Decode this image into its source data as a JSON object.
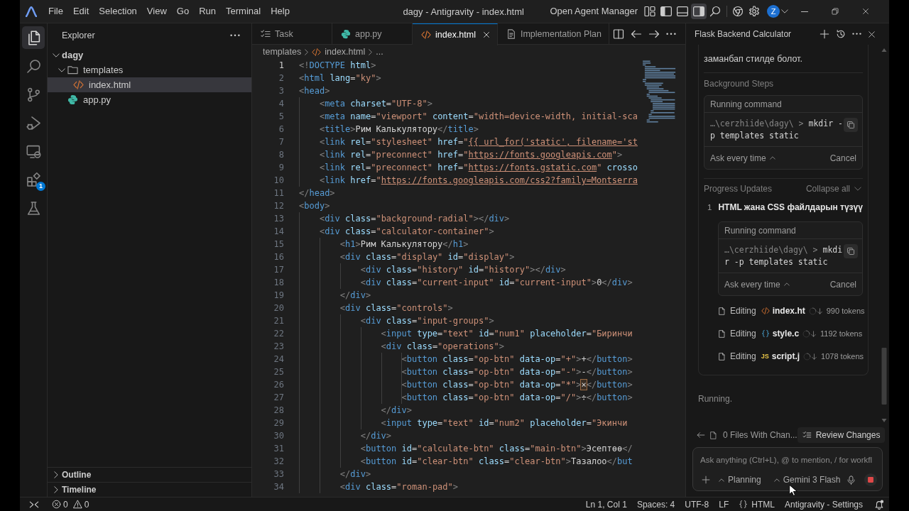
{
  "window": {
    "title": "dagy - Antigravity - index.html",
    "menu": [
      "File",
      "Edit",
      "Selection",
      "View",
      "Go",
      "Run",
      "Terminal",
      "Help"
    ],
    "agent_manager": "Open Agent Manager",
    "layout_toggles": [
      {
        "kind": "primary-sidebar",
        "on": true,
        "hovered": false
      },
      {
        "kind": "panel",
        "on": false,
        "hovered": false
      },
      {
        "kind": "secondary-sidebar",
        "on": true,
        "hovered": true
      }
    ],
    "account_initial": "Z"
  },
  "activity_bar": [
    {
      "kind": "explorer",
      "selected": true
    },
    {
      "kind": "search",
      "selected": false
    },
    {
      "kind": "source-control",
      "selected": false
    },
    {
      "kind": "run-debug",
      "selected": false
    },
    {
      "kind": "remote-explorer",
      "selected": false
    },
    {
      "kind": "extensions",
      "selected": false,
      "badge": "1"
    },
    {
      "kind": "testing",
      "selected": false
    }
  ],
  "explorer": {
    "title": "Explorer",
    "tree": [
      {
        "label": "dagy",
        "kind": "root",
        "expanded": true,
        "selected": false,
        "children": [
          {
            "label": "templates",
            "kind": "folder",
            "expanded": true,
            "selected": false,
            "children": [
              {
                "label": "index.html",
                "kind": "html",
                "selected": true
              }
            ]
          },
          {
            "label": "app.py",
            "kind": "python",
            "selected": false
          }
        ]
      }
    ],
    "sections": [
      {
        "label": "Outline",
        "expanded": false
      },
      {
        "label": "Timeline",
        "expanded": false
      }
    ]
  },
  "editor": {
    "tabs": [
      {
        "label": "Task",
        "kind": "task",
        "selected": false
      },
      {
        "label": "app.py",
        "kind": "python",
        "selected": false
      },
      {
        "label": "index.html",
        "kind": "html",
        "selected": true
      },
      {
        "label": "Implementation Plan",
        "kind": "document",
        "selected": false
      }
    ],
    "breadcrumb": [
      {
        "label": "templates",
        "kind": "folder"
      },
      {
        "label": "index.html",
        "kind": "html"
      },
      {
        "label": "...",
        "kind": "more"
      }
    ],
    "lines": [
      {
        "number": "1",
        "current": true,
        "segments": [
          {
            "kind": "code",
            "text": "<!DOCTYPE html>"
          }
        ]
      },
      {
        "number": "2",
        "current": false,
        "segments": [
          {
            "kind": "code",
            "text": "<html lang=\"ky\">"
          }
        ]
      },
      {
        "number": "3",
        "current": false,
        "segments": [
          {
            "kind": "code",
            "text": "<head>"
          }
        ]
      },
      {
        "number": "4",
        "current": false,
        "segments": [
          {
            "kind": "code",
            "text": "    <meta charset=\"UTF-8\">"
          }
        ]
      },
      {
        "number": "5",
        "current": false,
        "segments": [
          {
            "kind": "code",
            "text": "    <meta name=\"viewport\" content=\"width=device-width, initial-sca"
          }
        ]
      },
      {
        "number": "6",
        "current": false,
        "segments": [
          {
            "kind": "code",
            "text": "    <title>Рим Калькулятору</title>"
          }
        ]
      },
      {
        "number": "7",
        "current": false,
        "segments": [
          {
            "kind": "code",
            "text": "    <link rel=\"stylesheet\" href=\""
          },
          {
            "kind": "link",
            "text": "{{ url_for('static', filename='st"
          }
        ]
      },
      {
        "number": "8",
        "current": false,
        "segments": [
          {
            "kind": "code",
            "text": "    <link rel=\"preconnect\" href=\""
          },
          {
            "kind": "link",
            "text": "https://fonts.googleapis.com"
          },
          {
            "kind": "code",
            "text": "\">"
          }
        ]
      },
      {
        "number": "9",
        "current": false,
        "segments": [
          {
            "kind": "code",
            "text": "    <link rel=\"preconnect\" href=\""
          },
          {
            "kind": "link",
            "text": "https://fonts.gstatic.com"
          },
          {
            "kind": "code",
            "text": "\" crosso"
          }
        ]
      },
      {
        "number": "10",
        "current": false,
        "segments": [
          {
            "kind": "code",
            "text": "    <link href=\""
          },
          {
            "kind": "link",
            "text": "https://fonts.googleapis.com/css2?family=Montserra"
          }
        ]
      },
      {
        "number": "11",
        "current": false,
        "segments": [
          {
            "kind": "code",
            "text": "</head>"
          }
        ]
      },
      {
        "number": "12",
        "current": false,
        "segments": [
          {
            "kind": "code",
            "text": "<body>"
          }
        ]
      },
      {
        "number": "13",
        "current": false,
        "segments": [
          {
            "kind": "code",
            "text": "    <div class=\"background-radial\"></div>"
          }
        ]
      },
      {
        "number": "14",
        "current": false,
        "segments": [
          {
            "kind": "code",
            "text": "    <div class=\"calculator-container\">"
          }
        ]
      },
      {
        "number": "15",
        "current": false,
        "segments": [
          {
            "kind": "code",
            "text": "        <h1>Рим Калькулятору</h1>"
          }
        ]
      },
      {
        "number": "16",
        "current": false,
        "segments": [
          {
            "kind": "code",
            "text": "        <div class=\"display\" id=\"display\">"
          }
        ]
      },
      {
        "number": "17",
        "current": false,
        "segments": [
          {
            "kind": "code",
            "text": "            <div class=\"history\" id=\"history\"></div>"
          }
        ]
      },
      {
        "number": "18",
        "current": false,
        "segments": [
          {
            "kind": "code",
            "text": "            <div class=\"current-input\" id=\"current-input\">0</div>"
          }
        ]
      },
      {
        "number": "19",
        "current": false,
        "segments": [
          {
            "kind": "code",
            "text": "        </div>"
          }
        ]
      },
      {
        "number": "20",
        "current": false,
        "segments": [
          {
            "kind": "code",
            "text": "        <div class=\"controls\">"
          }
        ]
      },
      {
        "number": "21",
        "current": false,
        "segments": [
          {
            "kind": "code",
            "text": "            <div class=\"input-groups\">"
          }
        ]
      },
      {
        "number": "22",
        "current": false,
        "segments": [
          {
            "kind": "code",
            "text": "                <input type=\"text\" id=\"num1\" placeholder=\"Биринчи"
          }
        ]
      },
      {
        "number": "23",
        "current": false,
        "segments": [
          {
            "kind": "code",
            "text": "                <div class=\"operations\">"
          }
        ]
      },
      {
        "number": "24",
        "current": false,
        "segments": [
          {
            "kind": "code",
            "text": "                    <button class=\"op-btn\" data-op=\"+\">+</button>"
          }
        ]
      },
      {
        "number": "25",
        "current": false,
        "segments": [
          {
            "kind": "code",
            "text": "                    <button class=\"op-btn\" data-op=\"-\">-</button>"
          }
        ]
      },
      {
        "number": "26",
        "current": false,
        "segments": [
          {
            "kind": "code",
            "text": "                    <button class=\"op-btn\" data-op=\"*\">"
          },
          {
            "kind": "match",
            "text": "×"
          },
          {
            "kind": "code",
            "text": "</button>"
          }
        ]
      },
      {
        "number": "27",
        "current": false,
        "segments": [
          {
            "kind": "code",
            "text": "                    <button class=\"op-btn\" data-op=\"/\">÷</button>"
          }
        ]
      },
      {
        "number": "28",
        "current": false,
        "segments": [
          {
            "kind": "code",
            "text": "                </div>"
          }
        ]
      },
      {
        "number": "29",
        "current": false,
        "segments": [
          {
            "kind": "code",
            "text": "                <input type=\"text\" id=\"num2\" placeholder=\"Экинчи"
          }
        ]
      },
      {
        "number": "30",
        "current": false,
        "segments": [
          {
            "kind": "code",
            "text": "            </div>"
          }
        ]
      },
      {
        "number": "31",
        "current": false,
        "segments": [
          {
            "kind": "code",
            "text": "            <button id=\"calculate-btn\" class=\"main-btn\">Эсептөө</"
          }
        ]
      },
      {
        "number": "32",
        "current": false,
        "segments": [
          {
            "kind": "code",
            "text": "            <button id=\"clear-btn\" class=\"clear-btn\">Тазалоо</but"
          }
        ]
      },
      {
        "number": "33",
        "current": false,
        "segments": [
          {
            "kind": "code",
            "text": "        </div>"
          }
        ]
      },
      {
        "number": "34",
        "current": false,
        "segments": [
          {
            "kind": "code",
            "text": "        <div class=\"roman-pad\">"
          }
        ]
      }
    ]
  },
  "agent": {
    "title": "Flask Backend Calculator",
    "message_tail": "заманбап стилде болот.",
    "background_steps": {
      "title": "Background Steps",
      "command": {
        "title": "Running command",
        "path": "…\\cerzhiide\\dagy\\ >",
        "text": "mkdir -p templates static",
        "approval": "Ask every time",
        "cancel": "Cancel"
      }
    },
    "progress": {
      "title": "Progress Updates",
      "collapse": "Collapse all",
      "steps": [
        {
          "number": "1",
          "title": "HTML жана CSS файлдарын түзүү",
          "command": {
            "title": "Running command",
            "path": "…\\cerzhiide\\dagy\\ >",
            "text": "mkdir -p templates static",
            "approval": "Ask every time",
            "cancel": "Cancel"
          },
          "edits": [
            {
              "action": "Editing",
              "kind": "html",
              "file": "index.ht",
              "tokens": "990 tokens"
            },
            {
              "action": "Editing",
              "kind": "css",
              "file": "style.c",
              "tokens": "1192 tokens"
            },
            {
              "action": "Editing",
              "kind": "js",
              "icon_label": "JS",
              "file": "script.j",
              "tokens": "1078 tokens"
            }
          ]
        }
      ]
    },
    "status": "Running.",
    "changes": "0 Files With Chan...",
    "review": "Review Changes",
    "input": {
      "placeholder": "Ask anything (Ctrl+L), @ to mention, / for workfl"
    },
    "mode": "Planning",
    "model": "Gemini 3 Flash"
  },
  "status_bar": {
    "errors": "0",
    "warnings": "0",
    "items": [
      {
        "kind": "text",
        "label": "Ln 1, Col 1"
      },
      {
        "kind": "text",
        "label": "Spaces: 4"
      },
      {
        "kind": "text",
        "label": "UTF-8"
      },
      {
        "kind": "text",
        "label": "LF"
      },
      {
        "kind": "language",
        "label": "HTML"
      },
      {
        "kind": "text",
        "label": "Antigravity - Settings"
      }
    ]
  }
}
